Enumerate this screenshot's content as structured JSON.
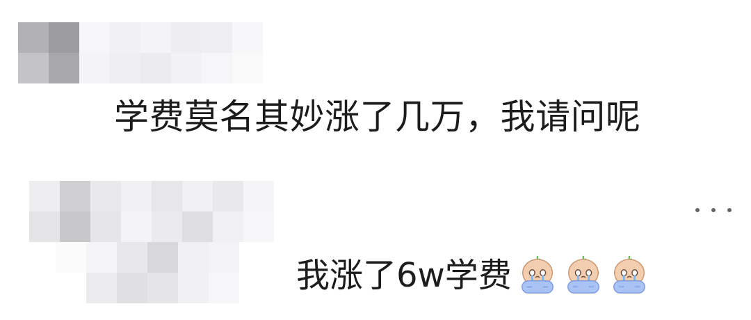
{
  "comment": {
    "text": "学费莫名其妙涨了几万，我请问呢"
  },
  "reply": {
    "text": "我涨了6w学费",
    "emojis": [
      "crying-emoji",
      "crying-emoji",
      "crying-emoji"
    ],
    "more_icon": "more-icon"
  },
  "colors": {
    "text": "#1c1c1c",
    "emoji_body": "#f3cdb0",
    "emoji_blanket": "#a9c3f5",
    "mosaic_dark": "#9d9ca1",
    "mosaic_light": "#f4f4f6"
  }
}
